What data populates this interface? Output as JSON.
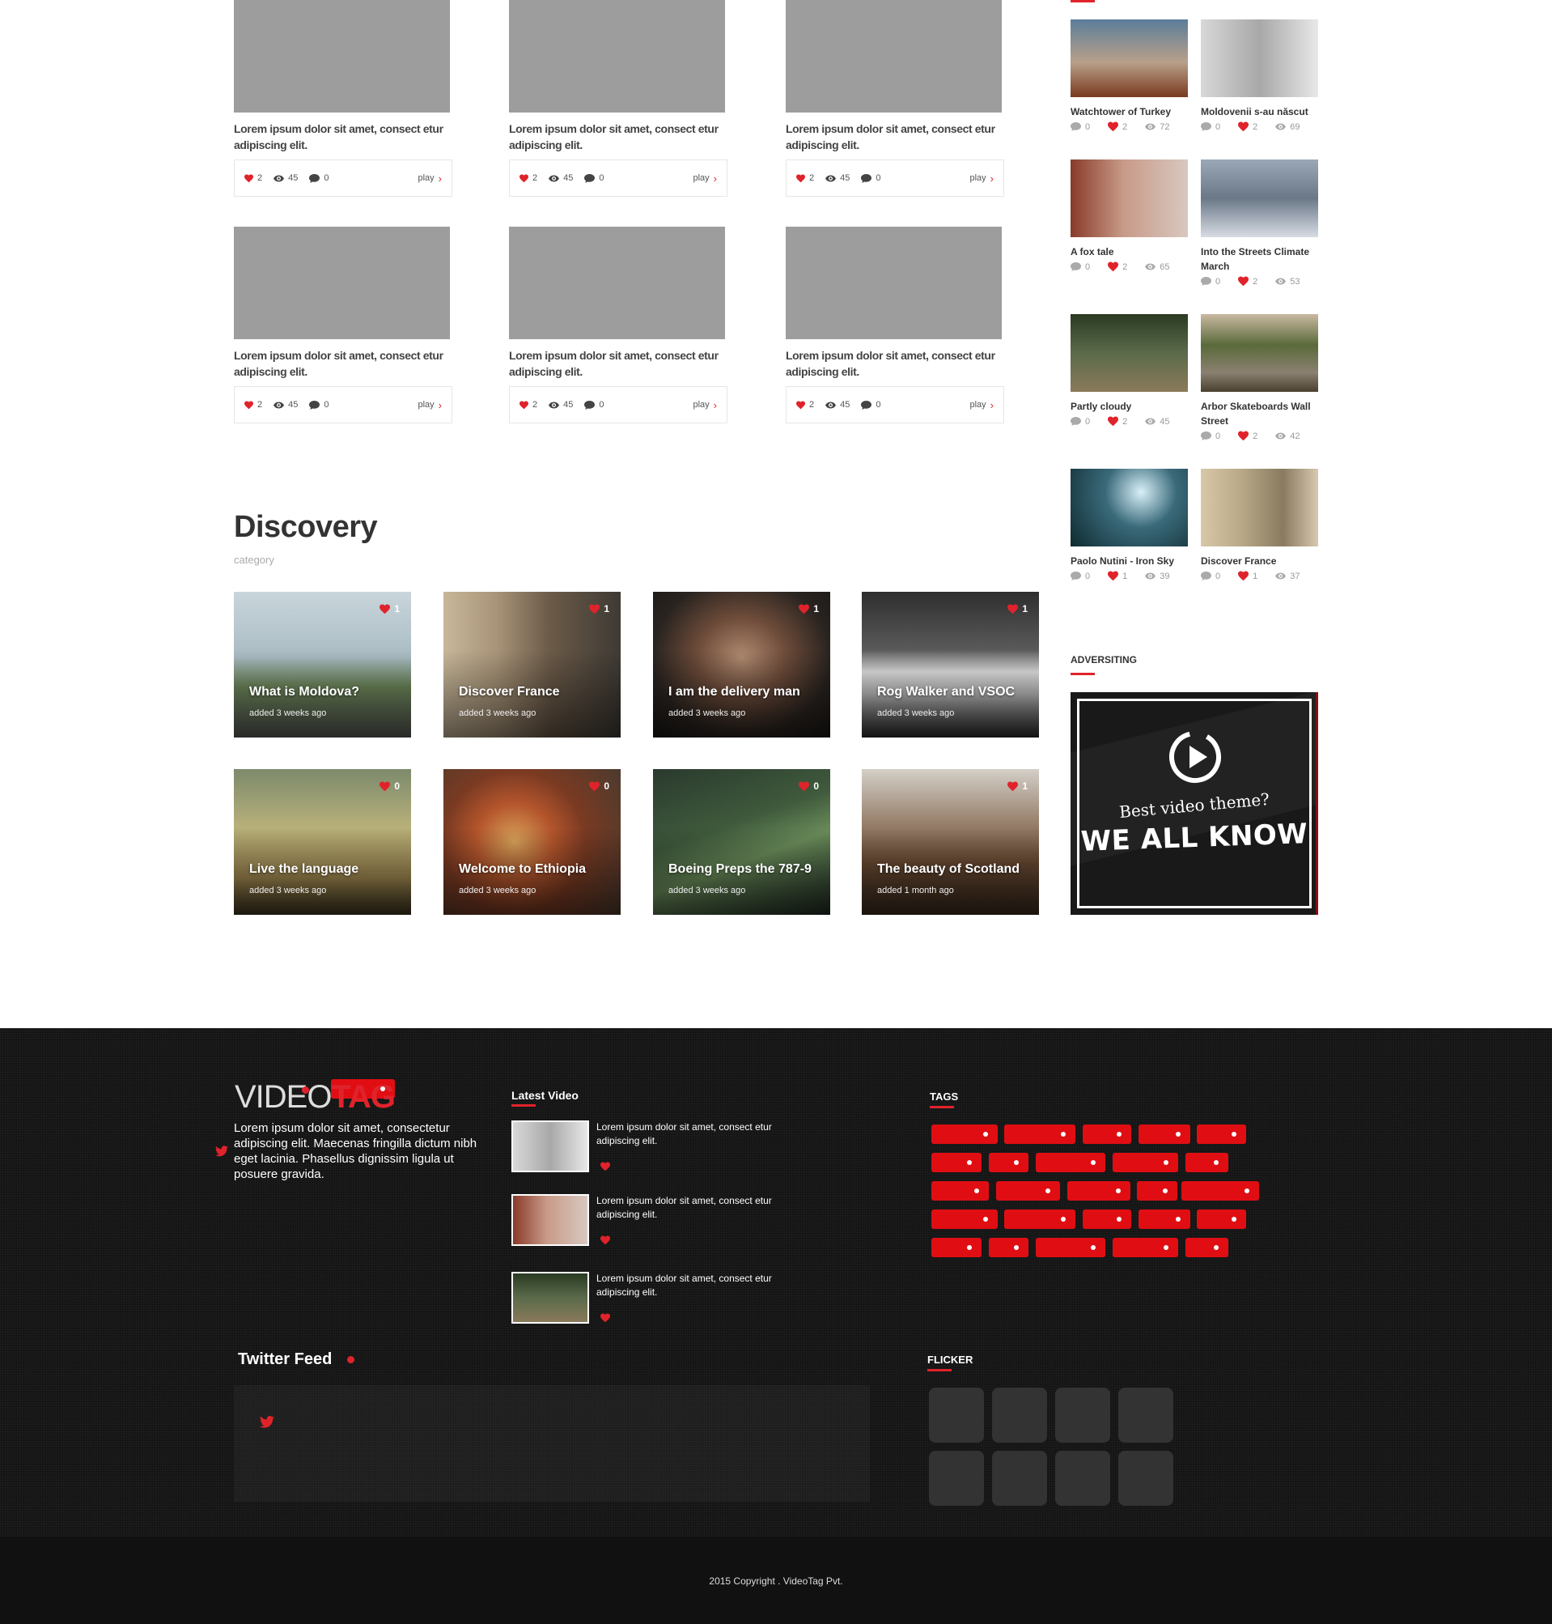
{
  "video_grid": {
    "items": [
      {
        "title": "Lorem ipsum dolor sit amet, consect etur adipiscing elit.",
        "likes": "2",
        "views": "45",
        "comments": "0",
        "play_label": "play"
      },
      {
        "title": "Lorem ipsum dolor sit amet, consect etur adipiscing elit.",
        "likes": "2",
        "views": "45",
        "comments": "0",
        "play_label": "play"
      },
      {
        "title": "Lorem ipsum dolor sit amet, consect etur adipiscing elit.",
        "likes": "2",
        "views": "45",
        "comments": "0",
        "play_label": "play"
      },
      {
        "title": "Lorem ipsum dolor sit amet, consect etur adipiscing elit.",
        "likes": "2",
        "views": "45",
        "comments": "0",
        "play_label": "play"
      },
      {
        "title": "Lorem ipsum dolor sit amet, consect etur adipiscing elit.",
        "likes": "2",
        "views": "45",
        "comments": "0",
        "play_label": "play"
      },
      {
        "title": "Lorem ipsum dolor sit amet, consect etur adipiscing elit.",
        "likes": "2",
        "views": "45",
        "comments": "0",
        "play_label": "play"
      }
    ]
  },
  "discovery": {
    "title": "Discovery",
    "subtitle": "category",
    "items": [
      {
        "title": "What is Moldova?",
        "added": "added 3 weeks ago",
        "likes": "1"
      },
      {
        "title": "Discover France",
        "added": "added 3 weeks ago",
        "likes": "1"
      },
      {
        "title": "I am the delivery man",
        "added": "added 3 weeks ago",
        "likes": "1"
      },
      {
        "title": "Rog Walker and VSOC",
        "added": "added 3 weeks ago",
        "likes": "1"
      },
      {
        "title": "Live the language",
        "added": "added 3 weeks ago",
        "likes": "0"
      },
      {
        "title": "Welcome to Ethiopia",
        "added": "added 3 weeks ago",
        "likes": "0"
      },
      {
        "title": "Boeing Preps the 787-9",
        "added": "added 3 weeks ago",
        "likes": "0"
      },
      {
        "title": "The beauty of Scotland",
        "added": "added 1 month ago",
        "likes": "1"
      }
    ]
  },
  "sidebar": {
    "videos": [
      {
        "title": "Watchtower of Turkey",
        "comments": "0",
        "likes": "2",
        "views": "72"
      },
      {
        "title": "Moldovenii s-au născut",
        "comments": "0",
        "likes": "2",
        "views": "69"
      },
      {
        "title": "A fox tale",
        "comments": "0",
        "likes": "2",
        "views": "65"
      },
      {
        "title": "Into the Streets Climate March",
        "comments": "0",
        "likes": "2",
        "views": "53"
      },
      {
        "title": "Partly cloudy",
        "comments": "0",
        "likes": "2",
        "views": "45"
      },
      {
        "title": "Arbor Skateboards Wall Street",
        "comments": "0",
        "likes": "2",
        "views": "42"
      },
      {
        "title": "Paolo Nutini - Iron Sky",
        "comments": "0",
        "likes": "1",
        "views": "39"
      },
      {
        "title": "Discover France",
        "comments": "0",
        "likes": "1",
        "views": "37"
      }
    ],
    "adv_title": "ADVERSITING",
    "ad": {
      "line1": "Best video theme?",
      "line2": "WE ALL KNOW"
    }
  },
  "footer": {
    "logo_part1": "VIDEO",
    "logo_part2": "TAG",
    "about": "Lorem ipsum dolor sit amet, consectetur adipiscing elit. Maecenas fringilla dictum nibh eget lacinia. Phasellus dignissim ligula ut posuere gravida.",
    "latest_title": "Latest Video",
    "latest": [
      {
        "text": "Lorem ipsum dolor sit amet, consect etur adipiscing elit."
      },
      {
        "text": "Lorem ipsum dolor sit amet, consect etur adipiscing elit."
      },
      {
        "text": "Lorem ipsum dolor sit amet, consect etur adipiscing elit."
      }
    ],
    "tags_title": "TAGS",
    "twitter_title": "Twitter Feed",
    "flicker_title": "FLICKER",
    "copyright": "2015 Copyright . VideoTag Pvt."
  },
  "colors": {
    "accent": "#e0232b",
    "footer_bg": "#141414",
    "placeholder_gray": "#9d9d9d"
  }
}
